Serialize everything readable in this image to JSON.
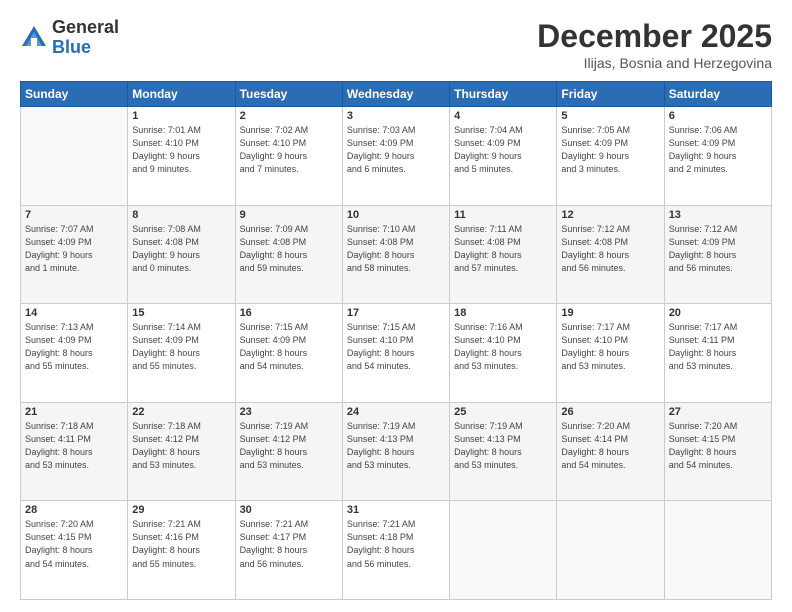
{
  "header": {
    "logo_general": "General",
    "logo_blue": "Blue",
    "title": "December 2025",
    "location": "Ilijas, Bosnia and Herzegovina"
  },
  "weekdays": [
    "Sunday",
    "Monday",
    "Tuesday",
    "Wednesday",
    "Thursday",
    "Friday",
    "Saturday"
  ],
  "weeks": [
    [
      {
        "day": "",
        "info": ""
      },
      {
        "day": "1",
        "info": "Sunrise: 7:01 AM\nSunset: 4:10 PM\nDaylight: 9 hours\nand 9 minutes."
      },
      {
        "day": "2",
        "info": "Sunrise: 7:02 AM\nSunset: 4:10 PM\nDaylight: 9 hours\nand 7 minutes."
      },
      {
        "day": "3",
        "info": "Sunrise: 7:03 AM\nSunset: 4:09 PM\nDaylight: 9 hours\nand 6 minutes."
      },
      {
        "day": "4",
        "info": "Sunrise: 7:04 AM\nSunset: 4:09 PM\nDaylight: 9 hours\nand 5 minutes."
      },
      {
        "day": "5",
        "info": "Sunrise: 7:05 AM\nSunset: 4:09 PM\nDaylight: 9 hours\nand 3 minutes."
      },
      {
        "day": "6",
        "info": "Sunrise: 7:06 AM\nSunset: 4:09 PM\nDaylight: 9 hours\nand 2 minutes."
      }
    ],
    [
      {
        "day": "7",
        "info": "Sunrise: 7:07 AM\nSunset: 4:09 PM\nDaylight: 9 hours\nand 1 minute."
      },
      {
        "day": "8",
        "info": "Sunrise: 7:08 AM\nSunset: 4:08 PM\nDaylight: 9 hours\nand 0 minutes."
      },
      {
        "day": "9",
        "info": "Sunrise: 7:09 AM\nSunset: 4:08 PM\nDaylight: 8 hours\nand 59 minutes."
      },
      {
        "day": "10",
        "info": "Sunrise: 7:10 AM\nSunset: 4:08 PM\nDaylight: 8 hours\nand 58 minutes."
      },
      {
        "day": "11",
        "info": "Sunrise: 7:11 AM\nSunset: 4:08 PM\nDaylight: 8 hours\nand 57 minutes."
      },
      {
        "day": "12",
        "info": "Sunrise: 7:12 AM\nSunset: 4:08 PM\nDaylight: 8 hours\nand 56 minutes."
      },
      {
        "day": "13",
        "info": "Sunrise: 7:12 AM\nSunset: 4:09 PM\nDaylight: 8 hours\nand 56 minutes."
      }
    ],
    [
      {
        "day": "14",
        "info": "Sunrise: 7:13 AM\nSunset: 4:09 PM\nDaylight: 8 hours\nand 55 minutes."
      },
      {
        "day": "15",
        "info": "Sunrise: 7:14 AM\nSunset: 4:09 PM\nDaylight: 8 hours\nand 55 minutes."
      },
      {
        "day": "16",
        "info": "Sunrise: 7:15 AM\nSunset: 4:09 PM\nDaylight: 8 hours\nand 54 minutes."
      },
      {
        "day": "17",
        "info": "Sunrise: 7:15 AM\nSunset: 4:10 PM\nDaylight: 8 hours\nand 54 minutes."
      },
      {
        "day": "18",
        "info": "Sunrise: 7:16 AM\nSunset: 4:10 PM\nDaylight: 8 hours\nand 53 minutes."
      },
      {
        "day": "19",
        "info": "Sunrise: 7:17 AM\nSunset: 4:10 PM\nDaylight: 8 hours\nand 53 minutes."
      },
      {
        "day": "20",
        "info": "Sunrise: 7:17 AM\nSunset: 4:11 PM\nDaylight: 8 hours\nand 53 minutes."
      }
    ],
    [
      {
        "day": "21",
        "info": "Sunrise: 7:18 AM\nSunset: 4:11 PM\nDaylight: 8 hours\nand 53 minutes."
      },
      {
        "day": "22",
        "info": "Sunrise: 7:18 AM\nSunset: 4:12 PM\nDaylight: 8 hours\nand 53 minutes."
      },
      {
        "day": "23",
        "info": "Sunrise: 7:19 AM\nSunset: 4:12 PM\nDaylight: 8 hours\nand 53 minutes."
      },
      {
        "day": "24",
        "info": "Sunrise: 7:19 AM\nSunset: 4:13 PM\nDaylight: 8 hours\nand 53 minutes."
      },
      {
        "day": "25",
        "info": "Sunrise: 7:19 AM\nSunset: 4:13 PM\nDaylight: 8 hours\nand 53 minutes."
      },
      {
        "day": "26",
        "info": "Sunrise: 7:20 AM\nSunset: 4:14 PM\nDaylight: 8 hours\nand 54 minutes."
      },
      {
        "day": "27",
        "info": "Sunrise: 7:20 AM\nSunset: 4:15 PM\nDaylight: 8 hours\nand 54 minutes."
      }
    ],
    [
      {
        "day": "28",
        "info": "Sunrise: 7:20 AM\nSunset: 4:15 PM\nDaylight: 8 hours\nand 54 minutes."
      },
      {
        "day": "29",
        "info": "Sunrise: 7:21 AM\nSunset: 4:16 PM\nDaylight: 8 hours\nand 55 minutes."
      },
      {
        "day": "30",
        "info": "Sunrise: 7:21 AM\nSunset: 4:17 PM\nDaylight: 8 hours\nand 56 minutes."
      },
      {
        "day": "31",
        "info": "Sunrise: 7:21 AM\nSunset: 4:18 PM\nDaylight: 8 hours\nand 56 minutes."
      },
      {
        "day": "",
        "info": ""
      },
      {
        "day": "",
        "info": ""
      },
      {
        "day": "",
        "info": ""
      }
    ]
  ]
}
